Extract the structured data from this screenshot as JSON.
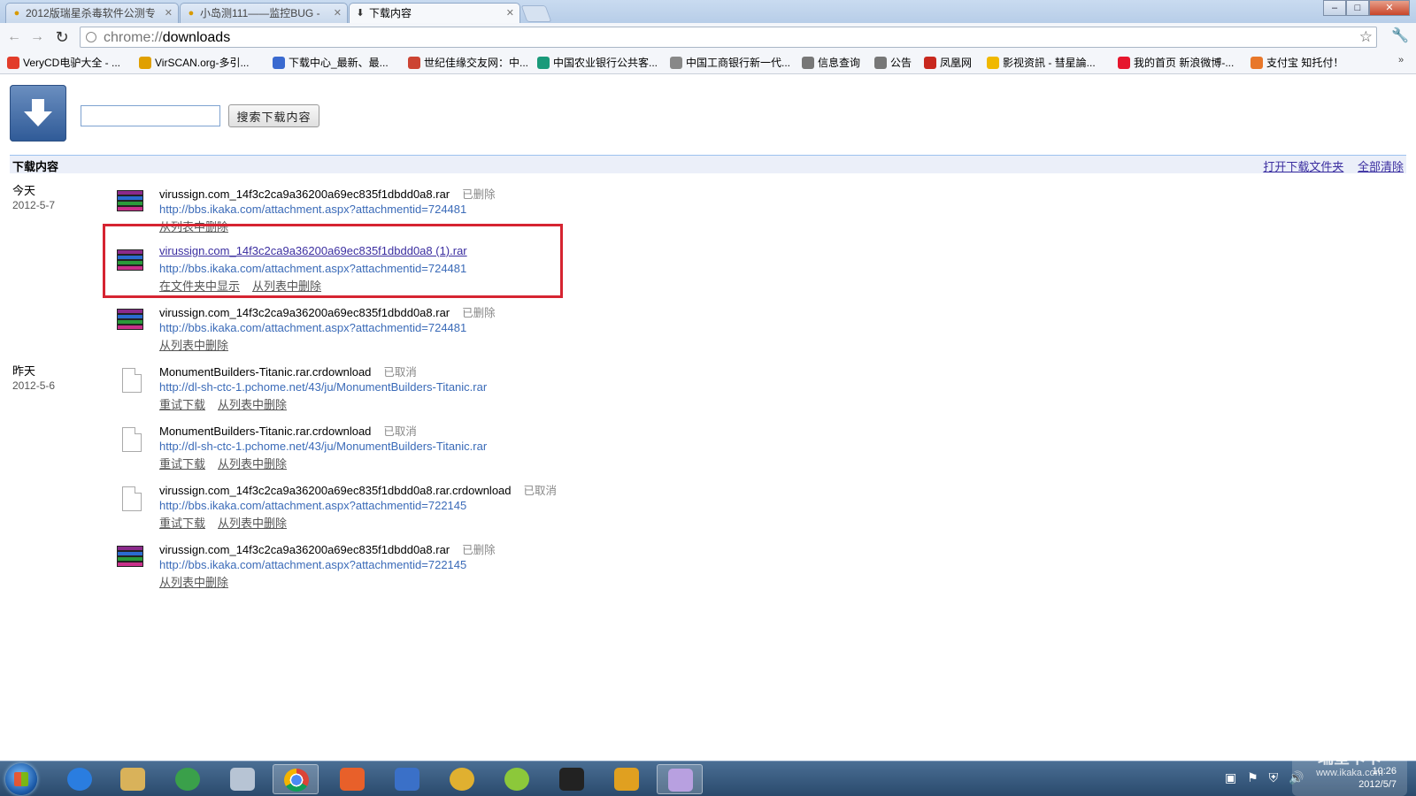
{
  "browser": {
    "tabs": [
      {
        "title": "2012版瑞星杀毒软件公测专",
        "active": false
      },
      {
        "title": "小岛测111——监控BUG -",
        "active": false
      },
      {
        "title": "下载内容",
        "active": true
      }
    ],
    "url_scheme": "chrome://",
    "url_host": "downloads"
  },
  "bookmarks": [
    {
      "label": "VeryCD电驴大全 - ...",
      "icon": "verycd-icon",
      "color": "#e23c2a"
    },
    {
      "label": "VirSCAN.org-多引...",
      "icon": "virscan-icon",
      "color": "#e0a000"
    },
    {
      "label": "下载中心_最新、最...",
      "icon": "download-center-icon",
      "color": "#3a6ad0"
    },
    {
      "label": "世纪佳缘交友网：中...",
      "icon": "jiayuan-icon",
      "color": "#c43"
    },
    {
      "label": "中国农业银行公共客...",
      "icon": "abc-bank-icon",
      "color": "#1a9a7a"
    },
    {
      "label": "中国工商银行新一代...",
      "icon": "icbc-icon",
      "color": "#888"
    },
    {
      "label": "信息查询",
      "icon": "document-icon",
      "color": "#777"
    },
    {
      "label": "公告",
      "icon": "document-icon",
      "color": "#777"
    },
    {
      "label": "凤凰网",
      "icon": "ifeng-icon",
      "color": "#c8281e"
    },
    {
      "label": "影视资訊 - 彗星論...",
      "icon": "comet-icon",
      "color": "#f0b800"
    },
    {
      "label": "我的首页 新浪微博-...",
      "icon": "weibo-icon",
      "color": "#e6162d"
    },
    {
      "label": "支付宝 知托付！",
      "icon": "alipay-icon",
      "color": "#e8772a"
    }
  ],
  "downloads_page": {
    "search_button": "搜索下载内容",
    "section_title": "下载内容",
    "open_folder": "打开下载文件夹",
    "clear_all": "全部清除",
    "groups": [
      {
        "day": "今天",
        "date": "2012-5-7",
        "items": [
          {
            "name": "virussign.com_14f3c2ca9a36200a69ec835f1dbdd0a8.rar",
            "status": "已删除",
            "url": "http://bbs.ikaka.com/attachment.aspx?attachmentid=724481",
            "actions": [
              "从列表中删除"
            ],
            "type": "rar",
            "link": false
          },
          {
            "name": "virussign.com_14f3c2ca9a36200a69ec835f1dbdd0a8 (1).rar",
            "status": "",
            "url": "http://bbs.ikaka.com/attachment.aspx?attachmentid=724481",
            "actions": [
              "在文件夹中显示",
              "从列表中删除"
            ],
            "type": "rar",
            "link": true
          },
          {
            "name": "virussign.com_14f3c2ca9a36200a69ec835f1dbdd0a8.rar",
            "status": "已删除",
            "url": "http://bbs.ikaka.com/attachment.aspx?attachmentid=724481",
            "actions": [
              "从列表中删除"
            ],
            "type": "rar",
            "link": false
          }
        ]
      },
      {
        "day": "昨天",
        "date": "2012-5-6",
        "items": [
          {
            "name": "MonumentBuilders-Titanic.rar.crdownload",
            "status": "已取消",
            "url": "http://dl-sh-ctc-1.pchome.net/43/ju/MonumentBuilders-Titanic.rar",
            "actions": [
              "重试下载",
              "从列表中删除"
            ],
            "type": "blank",
            "link": false
          },
          {
            "name": "MonumentBuilders-Titanic.rar.crdownload",
            "status": "已取消",
            "url": "http://dl-sh-ctc-1.pchome.net/43/ju/MonumentBuilders-Titanic.rar",
            "actions": [
              "重试下载",
              "从列表中删除"
            ],
            "type": "blank",
            "link": false
          },
          {
            "name": "virussign.com_14f3c2ca9a36200a69ec835f1dbdd0a8.rar.crdownload",
            "status": "已取消",
            "url": "http://bbs.ikaka.com/attachment.aspx?attachmentid=722145",
            "actions": [
              "重试下载",
              "从列表中删除"
            ],
            "type": "blank",
            "link": false
          },
          {
            "name": "virussign.com_14f3c2ca9a36200a69ec835f1dbdd0a8.rar",
            "status": "已删除",
            "url": "http://bbs.ikaka.com/attachment.aspx?attachmentid=722145",
            "actions": [
              "从列表中删除"
            ],
            "type": "rar",
            "link": false
          }
        ]
      }
    ]
  },
  "taskbar": {
    "apps": [
      "ie-icon",
      "explorer-icon",
      "network-icon",
      "calculator-icon",
      "chrome-icon",
      "app-icon",
      "rising-firewall-icon",
      "rising-icon",
      "leaf-icon",
      "qq-icon",
      "lion-icon",
      "paint-icon"
    ],
    "clock_time": "10:26",
    "clock_date": "2012/5/7"
  },
  "watermark": {
    "title": "瑞星卡卡",
    "url": "www.ikaka.com"
  },
  "colors": {
    "accent": "#3b6bb8",
    "highlight": "#d62431",
    "link": "#3b2ea0"
  }
}
